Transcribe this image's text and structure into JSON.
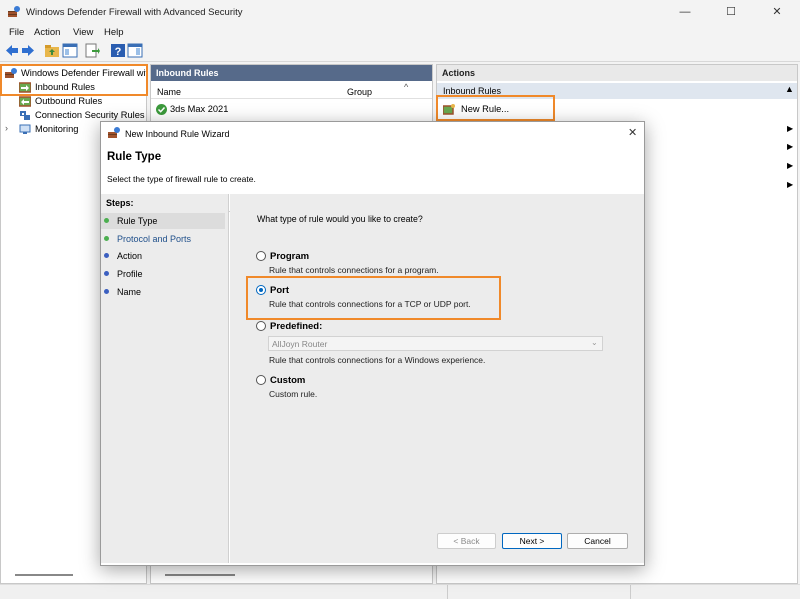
{
  "window": {
    "title": "Windows Defender Firewall with Advanced Security",
    "minimize": "—",
    "maximize": "☐",
    "close": "✕"
  },
  "menu": [
    "File",
    "Action",
    "View",
    "Help"
  ],
  "tree": {
    "root": "Windows Defender Firewall wit",
    "items": [
      "Inbound Rules",
      "Outbound Rules",
      "Connection Security Rules",
      "Monitoring"
    ]
  },
  "middle": {
    "header": "Inbound Rules",
    "columns": [
      "Name",
      "Group"
    ],
    "rows": [
      "3ds Max 2021"
    ]
  },
  "actions": {
    "header": "Actions",
    "section": "Inbound Rules",
    "new_rule": "New Rule..."
  },
  "dialog": {
    "title": "New Inbound Rule Wizard",
    "heading": "Rule Type",
    "subheading": "Select the type of firewall rule to create.",
    "steps_label": "Steps:",
    "steps": [
      "Rule Type",
      "Protocol and Ports",
      "Action",
      "Profile",
      "Name"
    ],
    "question": "What type of rule would you like to create?",
    "options": [
      {
        "title": "Program",
        "desc": "Rule that controls connections for a program."
      },
      {
        "title": "Port",
        "desc": "Rule that controls connections for a TCP or UDP port."
      },
      {
        "title": "Predefined:",
        "desc": "Rule that controls connections for a Windows experience."
      },
      {
        "title": "Custom",
        "desc": "Custom rule."
      }
    ],
    "selected_option": "Port",
    "predefined_value": "AllJoyn Router",
    "back_label": "< Back",
    "next_label": "Next >",
    "cancel_label": "Cancel"
  },
  "colors": {
    "highlight": "#f0892a",
    "accent": "#0067c0",
    "pane_header": "#566a8a",
    "step_active": "#4caf50",
    "step_pending": "#3b5fc0"
  }
}
